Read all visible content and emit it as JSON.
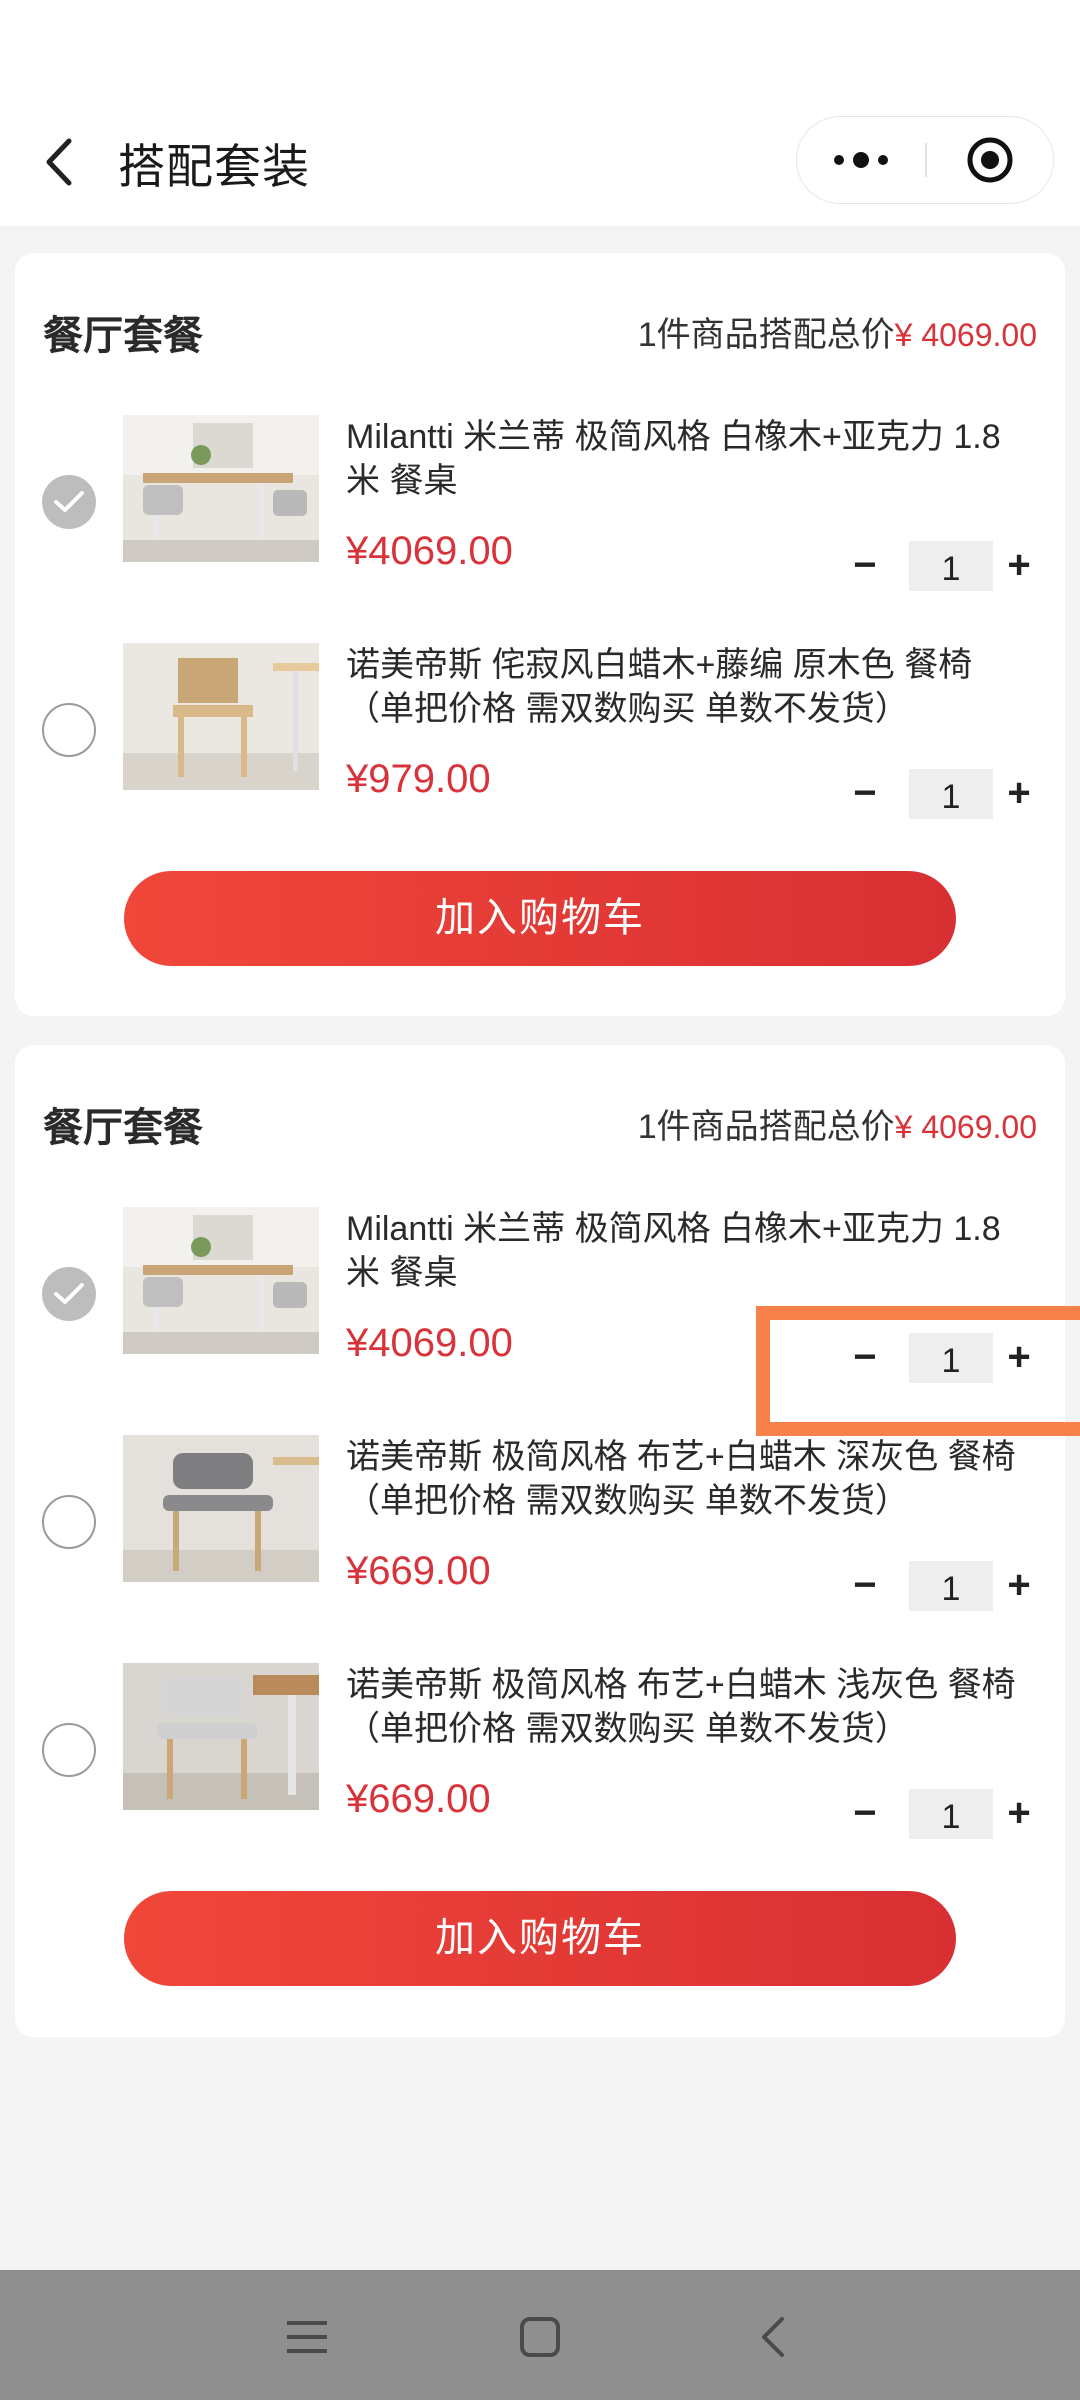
{
  "header": {
    "title": "搭配套装",
    "back_icon": "chevron-left-icon",
    "more_icon": "more-dots-icon",
    "target_icon": "target-circle-icon"
  },
  "colors": {
    "accent": "#d8333a",
    "button_start": "#f0473a",
    "button_end": "#d82f33",
    "highlight": "#f7814a"
  },
  "bundles": [
    {
      "title": "餐厅套餐",
      "total_prefix": "1件商品搭配总价",
      "total_price": "¥ 4069.00",
      "cart_label": "加入购物车",
      "items": [
        {
          "name": "Milantti 米兰蒂 极简风格 白橡木+亚克力 1.8米 餐桌",
          "price": "¥4069.00",
          "qty": "1",
          "checked": true
        },
        {
          "name": "诺美帝斯 侘寂风白蜡木+藤编 原木色 餐椅（单把价格 需双数购买 单数不发货）",
          "price": "¥979.00",
          "qty": "1",
          "checked": false
        }
      ]
    },
    {
      "title": "餐厅套餐",
      "total_prefix": "1件商品搭配总价",
      "total_price": "¥ 4069.00",
      "cart_label": "加入购物车",
      "items": [
        {
          "name": "Milantti 米兰蒂 极简风格 白橡木+亚克力 1.8米 餐桌",
          "price": "¥4069.00",
          "qty": "1",
          "checked": true
        },
        {
          "name": "诺美帝斯 极简风格 布艺+白蜡木 深灰色 餐椅（单把价格 需双数购买 单数不发货）",
          "price": "¥669.00",
          "qty": "1",
          "checked": false
        },
        {
          "name": "诺美帝斯 极简风格 布艺+白蜡木 浅灰色 餐椅（单把价格 需双数购买 单数不发货）",
          "price": "¥669.00",
          "qty": "1",
          "checked": false
        }
      ]
    }
  ],
  "stepper": {
    "minus": "−",
    "plus": "+"
  },
  "navbar": {
    "menu_icon": "menu-lines-icon",
    "home_icon": "square-home-icon",
    "back_icon": "triangle-back-icon"
  }
}
